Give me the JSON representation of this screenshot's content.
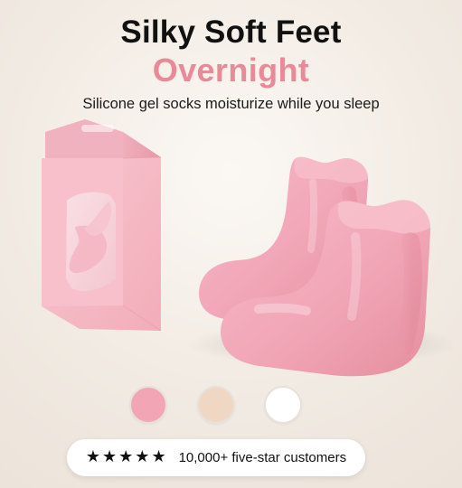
{
  "headline": {
    "line1": "Silky Soft Feet",
    "line2": "Overnight"
  },
  "subtitle": "Silicone gel socks moisturize while you sleep",
  "swatches": [
    {
      "color": "#f2a6b5"
    },
    {
      "color": "#f0d7c4"
    },
    {
      "color": "#ffffff"
    }
  ],
  "review": {
    "stars": "★★★★★",
    "text": "10,000+ five-star customers"
  },
  "colors": {
    "accent": "#e98a98",
    "title": "#111111",
    "background": "#f4efe9"
  }
}
